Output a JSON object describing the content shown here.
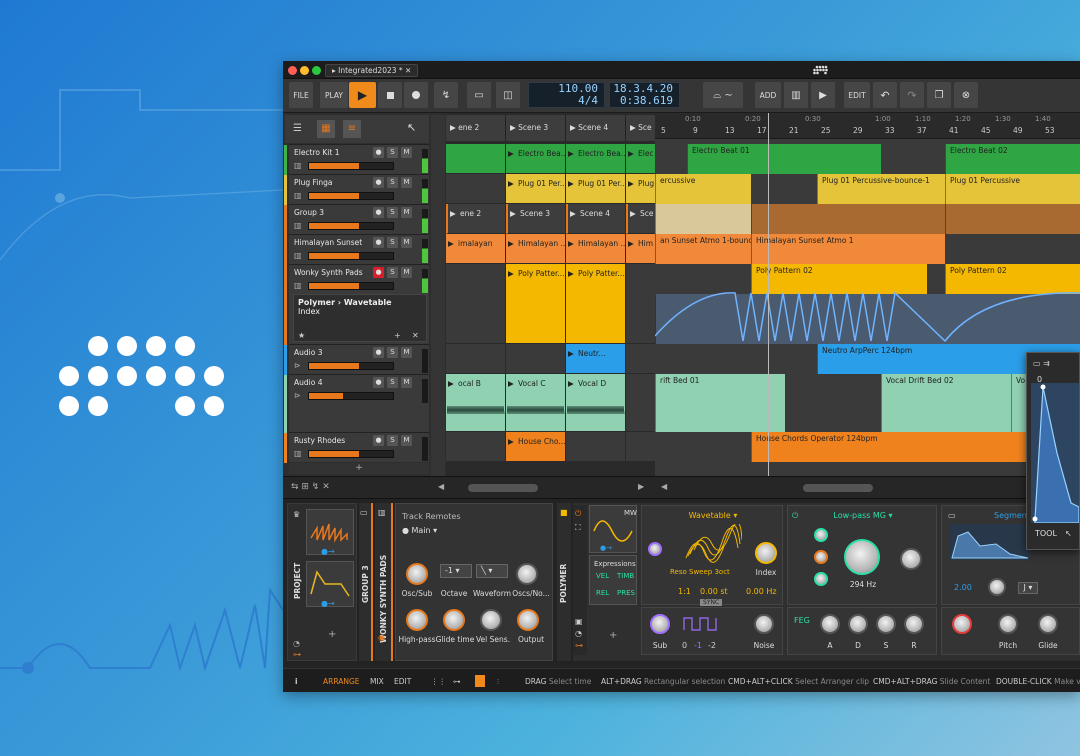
{
  "window": {
    "tab_title": "Integrated2023 *"
  },
  "toolbar": {
    "file": "FILE",
    "play": "PLAY",
    "add": "ADD",
    "edit": "EDIT",
    "tempo": "110.00",
    "signature": "4/4",
    "position": "18.3.4.20",
    "time": "0:38.619"
  },
  "tracks": [
    {
      "name": "Electro Kit 1",
      "color": "#3fb24a"
    },
    {
      "name": "Plug Finga",
      "color": "#e5c43a"
    },
    {
      "name": "Group 3",
      "color": "#e8781c"
    },
    {
      "name": "Himalayan Sunset",
      "color": "#e8781c"
    },
    {
      "name": "Wonky Synth Pads",
      "color": "#e8781c"
    },
    {
      "name": "Audio 3",
      "color": "#2a9ee8"
    },
    {
      "name": "Audio 4",
      "color": "#8fd1b0"
    },
    {
      "name": "Rusty Rhodes",
      "color": "#f0821e"
    }
  ],
  "mute_solo": {
    "s": "S",
    "m": "M"
  },
  "device_popup": {
    "title": "Polymer › Wavetable",
    "param": "Index"
  },
  "scenes": [
    "ene 2",
    "Scene 3",
    "Scene 4",
    "Sce"
  ],
  "clips": {
    "electro_slot": "Electro Bea...",
    "electro_cut": "Elec",
    "plug_slot": "Plug 01 Per...",
    "plug_cut": "Plug",
    "group_slots": [
      "ene 2",
      "Scene 3",
      "Scene 4",
      "Sce"
    ],
    "hima_slot": "Himalayan ...",
    "hima_left": "imalayan",
    "hima_cut": "Him",
    "poly_slot": "Poly Patter...",
    "neutr_slot": "Neutr...",
    "vocal_b": "ocal B",
    "vocal_c": "Vocal C",
    "vocal_d": "Vocal D",
    "house_slot": "House Cho..."
  },
  "ruler": [
    "5",
    "9",
    "13",
    "17",
    "21",
    "25",
    "29",
    "33",
    "37",
    "41",
    "45",
    "49",
    "53"
  ],
  "ruler_times": [
    "0:10",
    "0:20",
    "0:30",
    "1:00",
    "1:10",
    "1:20",
    "1:30",
    "1:40"
  ],
  "arranger_clips": {
    "electro_a": "Electro Beat 01",
    "electro_b": "Electro Beat 02",
    "perc_a": "ercussive",
    "perc_b": "Plug 01 Percussive-bounce-1",
    "perc_c": "Plug 01 Percussive",
    "hima_a": "an Sunset Atmo 1-bounce-1",
    "hima_b": "Himalayan Sunset Atmo 1",
    "poly_a": "Poly Pattern 02",
    "poly_b": "Poly Pattern 02",
    "neutro": "Neutro ArpPerc 124bpm",
    "drift_a": "rift Bed 01",
    "drift_b": "Vocal Drift Bed 02",
    "drift_c": "Vo",
    "house": "House Chords Operator 124bpm"
  },
  "devices": {
    "project": "PROJECT",
    "group": "GROUP 3",
    "track": "WONKY SYNTH PADS",
    "remotes_title": "Track Remotes",
    "remotes_page": "Main",
    "knobs": [
      "Osc/Sub",
      "Octave",
      "Waveform",
      "Oscs/No...",
      "High-pass",
      "Glide time",
      "Vel Sens.",
      "Output"
    ],
    "octave_val": "-1",
    "polymer": "POLYMER",
    "mw": "MW",
    "expressions": "Expressions",
    "exp": [
      "VEL",
      "TIMB",
      "REL",
      "PRES"
    ],
    "wavetable": "Wavetable",
    "wave_name": "Reso Sweep 3oct",
    "index": "Index",
    "ratio": "1:1",
    "st": "0.00 st",
    "hz": "0.00 Hz",
    "sync": "SYNC",
    "sub": "Sub",
    "noise": "Noise",
    "sub_vals": [
      "0",
      "-1",
      "-2"
    ],
    "filter": "Low-pass MG",
    "cutoff": "294 Hz",
    "feg": "FEG",
    "adsr": [
      "A",
      "D",
      "S",
      "R"
    ],
    "segments": "Segments",
    "seg_val": "2.00",
    "seg_note": "J",
    "pitch": "Pitch",
    "glide": "Glide",
    "tool": "TOOL",
    "zero": "0"
  },
  "status": {
    "arrange": "ARRANGE",
    "mix": "MIX",
    "edit": "EDIT",
    "hints": [
      {
        "k": "DRAG",
        "v": "Select time"
      },
      {
        "k": "ALT+DRAG",
        "v": "Rectangular selection"
      },
      {
        "k": "CMD+ALT+CLICK",
        "v": "Select Arranger clip"
      },
      {
        "k": "CMD+ALT+DRAG",
        "v": "Slide Content"
      },
      {
        "k": "DOUBLE-CLICK",
        "v": "Make vi"
      }
    ]
  },
  "colors": {
    "accent": "#e8781c",
    "green": "#3fb24a",
    "yellow": "#e5c43a",
    "blue": "#2a9ee8",
    "teal": "#8fd1b0",
    "wavetable": "#f5b800"
  }
}
